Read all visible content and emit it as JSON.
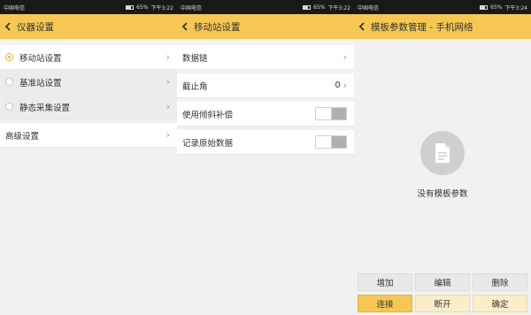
{
  "status": {
    "carrier": "中国电信",
    "battery_pct": "65%",
    "panels": [
      {
        "time": "下午3:22"
      },
      {
        "time": "下午3:22"
      },
      {
        "time": "下午3:24"
      }
    ]
  },
  "panel1": {
    "title": "仪器设置",
    "items": [
      {
        "label": "移动站设置",
        "selected": true
      },
      {
        "label": "基准站设置",
        "selected": false
      },
      {
        "label": "静态采集设置",
        "selected": false
      }
    ],
    "advanced_label": "高级设置"
  },
  "panel2": {
    "title": "移动站设置",
    "rows": {
      "datalink": "数据链",
      "cutoff_label": "截止角",
      "cutoff_value": "0",
      "tilt_label": "使用倾斜补偿",
      "raw_label": "记录原始数据"
    },
    "toggles": {
      "tilt": false,
      "raw": false
    }
  },
  "panel3": {
    "title": "模板参数管理 - 手机网络",
    "empty_text": "没有模板参数",
    "buttons": {
      "add": "增加",
      "edit": "编辑",
      "delete": "删除",
      "connect": "连接",
      "disconnect": "断开",
      "confirm": "确定"
    }
  },
  "colors": {
    "accent": "#f6c853",
    "statusbar": "#191919",
    "background": "#f1f1f1"
  },
  "icons": [
    "back-chevron-icon",
    "chevron-right-icon",
    "radio-icon",
    "document-icon",
    "battery-icon"
  ]
}
